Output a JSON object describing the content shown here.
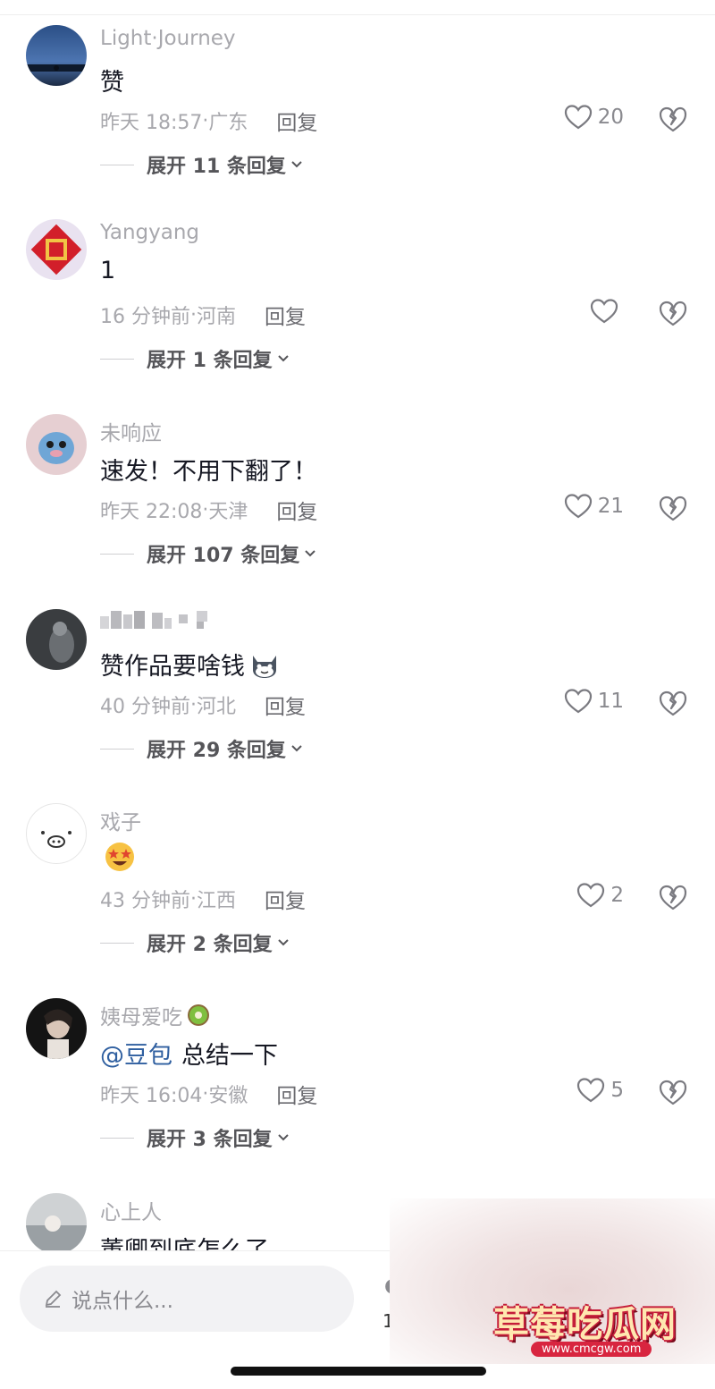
{
  "comments": [
    {
      "username": "Light·Journey",
      "content": "赞",
      "time": "昨天 18:57",
      "location": "广东",
      "reply_label": "回复",
      "likes": "20",
      "expand_label": "展开 11 条回复"
    },
    {
      "username": "Yangyang",
      "content": "1",
      "time": "16 分钟前",
      "location": "河南",
      "reply_label": "回复",
      "likes": "",
      "expand_label": "展开 1 条回复"
    },
    {
      "username": "未响应",
      "content": "速发！不用下翻了！",
      "time": "昨天 22:08",
      "location": "天津",
      "reply_label": "回复",
      "likes": "21",
      "expand_label": "展开 107 条回复"
    },
    {
      "username": "",
      "content": "赞作品要啥钱",
      "time": "40 分钟前",
      "location": "河北",
      "reply_label": "回复",
      "likes": "11",
      "expand_label": "展开 29 条回复"
    },
    {
      "username": "戏子",
      "content": "",
      "time": "43 分钟前",
      "location": "江西",
      "reply_label": "回复",
      "likes": "2",
      "expand_label": "展开 2 条回复"
    },
    {
      "username": "姨母爱吃",
      "mention": "@豆包",
      "content": "总结一下",
      "time": "昨天 16:04",
      "location": "安徽",
      "reply_label": "回复",
      "likes": "5",
      "expand_label": "展开 3 条回复"
    },
    {
      "username": "心上人",
      "content": "董卿到底怎么了"
    }
  ],
  "meta_separator": " · ",
  "input": {
    "placeholder": "说点什么..."
  },
  "bottom_partial": {
    "count": "1"
  },
  "watermark": {
    "title": "草莓吃瓜网",
    "url": "www.cmcgw.com"
  },
  "colors": {
    "meta_gray": "#a8a8ad",
    "mention_blue": "#2f5fa0",
    "input_bg": "#f2f2f4",
    "watermark_red": "#d8253f"
  }
}
